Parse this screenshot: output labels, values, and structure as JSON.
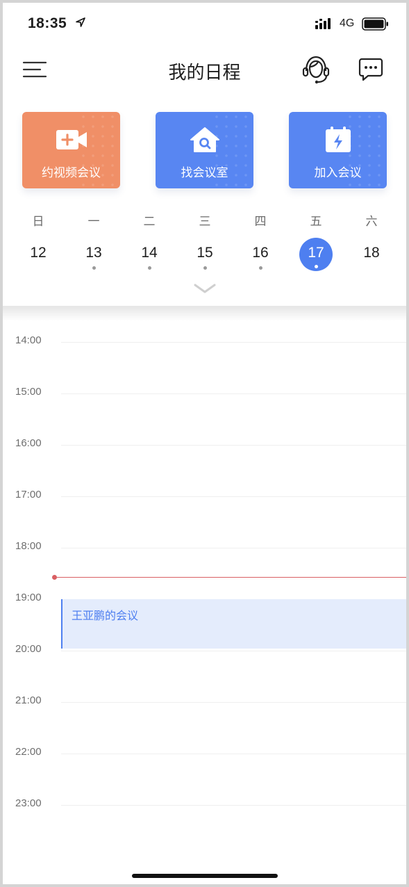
{
  "status_bar": {
    "time": "18:35",
    "network": "4G"
  },
  "header": {
    "title": "我的日程"
  },
  "actions": [
    {
      "label": "约视频会议",
      "icon": "video-plus-icon",
      "color": "#f08f67"
    },
    {
      "label": "找会议室",
      "icon": "house-search-icon",
      "color": "#5886f2"
    },
    {
      "label": "加入会议",
      "icon": "calendar-bolt-icon",
      "color": "#5886f2"
    }
  ],
  "week": {
    "days": [
      {
        "weekday": "日",
        "date": "12",
        "has_event": false,
        "selected": false
      },
      {
        "weekday": "一",
        "date": "13",
        "has_event": true,
        "selected": false
      },
      {
        "weekday": "二",
        "date": "14",
        "has_event": true,
        "selected": false
      },
      {
        "weekday": "三",
        "date": "15",
        "has_event": true,
        "selected": false
      },
      {
        "weekday": "四",
        "date": "16",
        "has_event": true,
        "selected": false
      },
      {
        "weekday": "五",
        "date": "17",
        "has_event": true,
        "selected": true
      },
      {
        "weekday": "六",
        "date": "18",
        "has_event": false,
        "selected": false
      }
    ]
  },
  "timeline": {
    "hours": [
      "14:00",
      "15:00",
      "16:00",
      "17:00",
      "18:00",
      "19:00",
      "20:00",
      "21:00",
      "22:00",
      "23:00"
    ],
    "current_time": "18:35",
    "events": [
      {
        "title": "王亚鹏的会议",
        "start": "19:00",
        "end": "20:00"
      }
    ]
  },
  "colors": {
    "accent": "#4e7ff0",
    "now_line": "#d95f63",
    "event_bg": "#e4ecfc"
  }
}
